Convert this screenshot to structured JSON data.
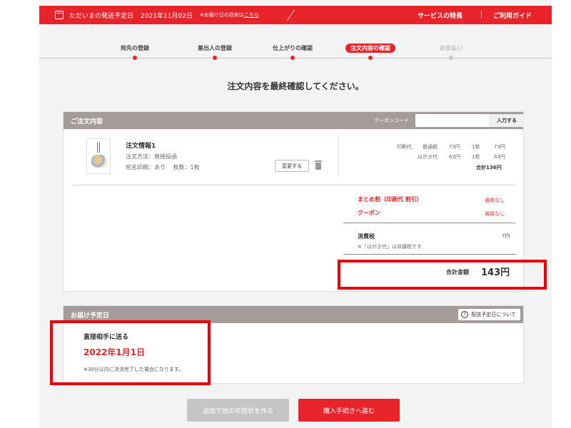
{
  "topbar": {
    "ship_label": "ただいまの発送予定日",
    "ship_date": "2021年11月02日",
    "note_prefix": "※お届け日の目安は",
    "note_link": "こちら",
    "nav_features": "サービスの特長",
    "nav_guide": "ご利用ガイド"
  },
  "steps": [
    {
      "label": "宛先の登録"
    },
    {
      "label": "差出人の登録"
    },
    {
      "label": "仕上がりの確認"
    },
    {
      "label": "注文内容の確認"
    },
    {
      "label": "お支払い"
    }
  ],
  "heading": "注文内容を最終確認してください。",
  "order_panel": {
    "title": "ご注文内容",
    "coupon_label": "クーポンコード",
    "coupon_value": "",
    "coupon_button": "入力する",
    "order_title": "注文情報1",
    "method": "注文方法：直接投函",
    "print_info": "宛名印刷：あり　 枚数：1枚",
    "change_button": "変更する",
    "prices": [
      {
        "label": "印刷代",
        "type": "普通紙",
        "unit": "73円",
        "qty": "1枚",
        "amount": "73円"
      },
      {
        "label": "はがき代",
        "type": "",
        "unit": "63円",
        "qty": "1枚",
        "amount": "63円"
      }
    ],
    "subtotal": "合計136円",
    "discount1_label": "まとめ割（印刷代 割引）",
    "discount1_value": "適用なし",
    "discount2_label": "クーポン",
    "discount2_value": "適用なし",
    "tax_label": "消費税",
    "tax_value": "7円",
    "tax_note": "※「はがき代」は非課税です",
    "total_label": "合計金額",
    "total_value": "143円"
  },
  "delivery_panel": {
    "title": "お届け予定日",
    "help_button": "配送予定日について",
    "method": "直接相手に送る",
    "date": "2022年1月1日",
    "note": "※30分以内に決済完了した場合になります。"
  },
  "buttons": {
    "add_more": "追加で他の年賀状を作る",
    "proceed": "購入手続きへ進む"
  },
  "colors": {
    "accent": "#e8242a",
    "header_gray": "#a39c9b",
    "highlight": "#e8000b"
  }
}
